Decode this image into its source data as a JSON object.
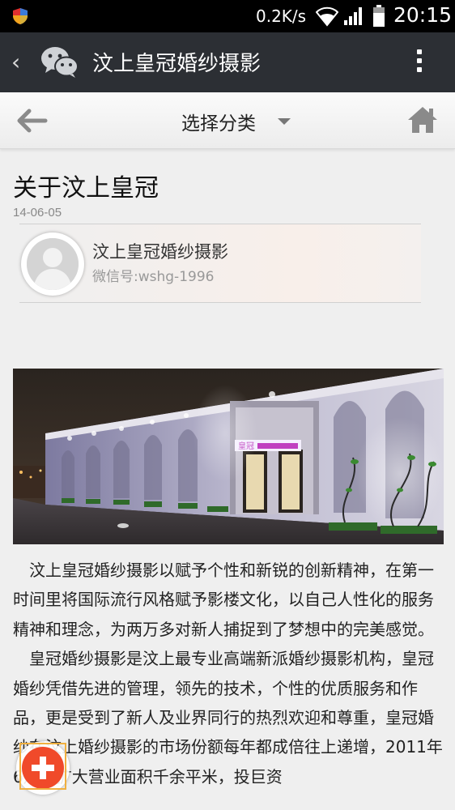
{
  "status_bar": {
    "net_speed": "0.2K/s",
    "time": "20:15",
    "icons": [
      "shield-icon",
      "wifi-icon",
      "signal-icon",
      "battery-icon"
    ]
  },
  "wechat_bar": {
    "back_glyph": "‹",
    "title": "汶上皇冠婚纱摄影",
    "icons": [
      "wechat-logo-icon",
      "more-vert-icon"
    ]
  },
  "nav": {
    "category_label": "选择分类",
    "icons": [
      "back-arrow-icon",
      "dropdown-caret-icon",
      "home-icon"
    ]
  },
  "article": {
    "title": "关于汶上皇冠",
    "date": "14-06-05",
    "account_name": "汶上皇冠婚纱摄影",
    "account_id": "微信号:wshg-1996",
    "paragraphs": [
      "汶上皇冠婚纱摄影以赋予个性和新锐的创新精神，在第一时间里将国际流行风格赋予影楼文化，以自己人性化的服务精神和理念，为两万多对新人捕捉到了梦想中的完美感觉。",
      "皇冠婚纱摄影是汶上最专业高端新派婚纱摄影机构，皇冠婚纱凭借先进的管理，领先的技术，个性的优质服务和作品，更是受到了新人及业界同行的热烈欢迎和尊重，皇冠婚纱在汶上婚纱摄影的市场份额每年都成倍往上递增，2011年6月又扩大营业面积千余平米，投巨资"
    ]
  },
  "colors": {
    "wechat_bar": "#2c2f34",
    "fab_red": "#f04a2a",
    "page_bg": "#efefef"
  }
}
